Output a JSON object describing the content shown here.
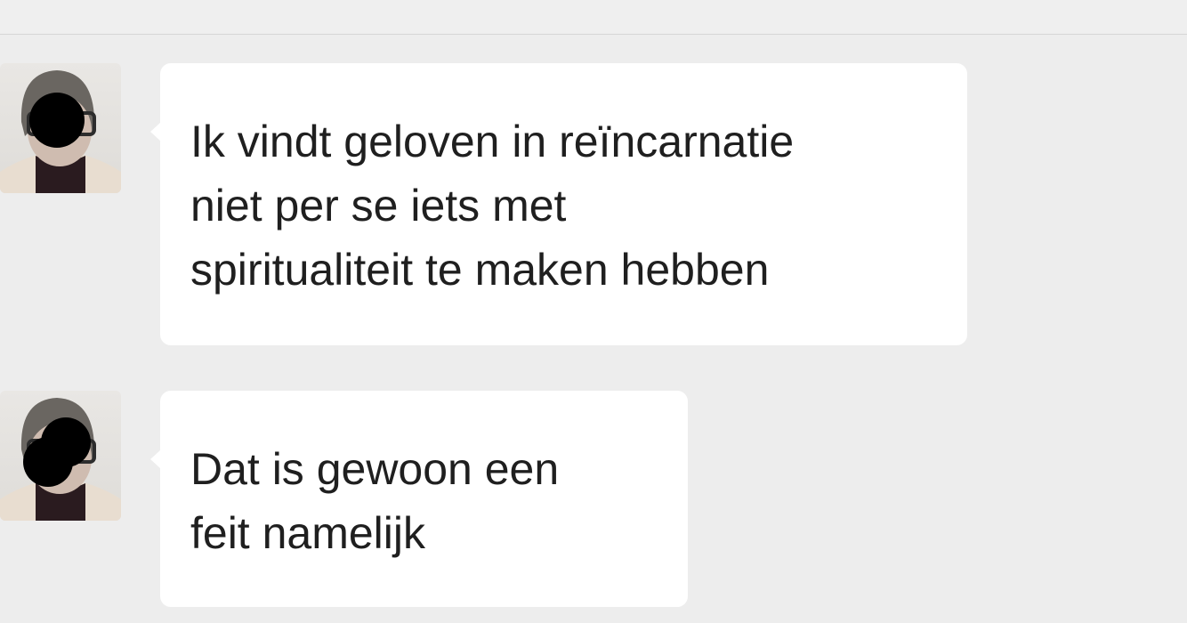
{
  "messages": [
    {
      "sender": "avatar",
      "lines": [
        "Ik vindt geloven in reïncarnatie",
        "niet per se iets met",
        "spiritualiteit te maken hebben"
      ]
    },
    {
      "sender": "avatar",
      "lines": [
        "Dat is gewoon een",
        "feit namelijk"
      ]
    }
  ],
  "colors": {
    "background": "#ededed",
    "bubble": "#ffffff",
    "text": "#1f1f1f",
    "redaction": "#000000"
  }
}
